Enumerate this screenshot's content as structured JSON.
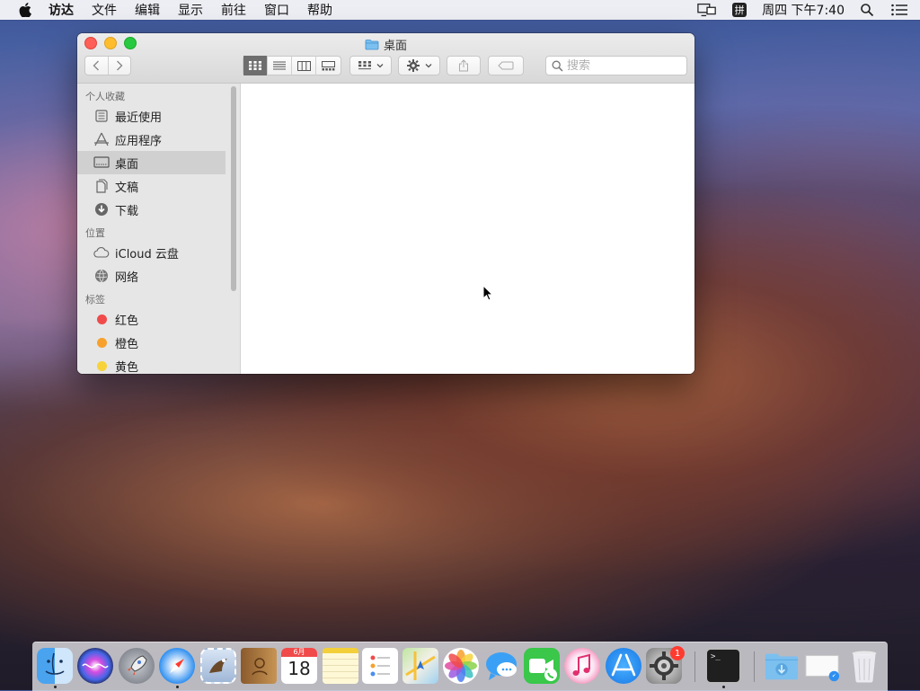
{
  "menubar": {
    "items": [
      "访达",
      "文件",
      "编辑",
      "显示",
      "前往",
      "窗口",
      "帮助"
    ],
    "input_method": "拼",
    "clock": "周四 下午7:40"
  },
  "window": {
    "title": "桌面",
    "search_placeholder": "搜索",
    "sidebar": {
      "favorites_header": "个人收藏",
      "favorites": [
        {
          "label": "最近使用",
          "icon": "recents-icon"
        },
        {
          "label": "应用程序",
          "icon": "applications-icon"
        },
        {
          "label": "桌面",
          "icon": "desktop-icon",
          "selected": true
        },
        {
          "label": "文稿",
          "icon": "documents-icon"
        },
        {
          "label": "下载",
          "icon": "downloads-icon"
        }
      ],
      "locations_header": "位置",
      "locations": [
        {
          "label": "iCloud 云盘",
          "icon": "icloud-icon"
        },
        {
          "label": "网络",
          "icon": "network-icon"
        }
      ],
      "tags_header": "标签",
      "tags": [
        {
          "label": "红色",
          "color": "#f04a4a"
        },
        {
          "label": "橙色",
          "color": "#f7a12c"
        },
        {
          "label": "黄色",
          "color": "#f7d23a"
        }
      ]
    }
  },
  "dock": {
    "apps": [
      {
        "name": "finder-app",
        "running": true
      },
      {
        "name": "siri-app"
      },
      {
        "name": "launchpad-app"
      },
      {
        "name": "safari-app",
        "running": true
      },
      {
        "name": "mail-app"
      },
      {
        "name": "contacts-app"
      },
      {
        "name": "calendar-app",
        "month": "6月",
        "day": "18"
      },
      {
        "name": "notes-app"
      },
      {
        "name": "reminders-app"
      },
      {
        "name": "maps-app"
      },
      {
        "name": "photos-app"
      },
      {
        "name": "messages-app"
      },
      {
        "name": "facetime-app"
      },
      {
        "name": "itunes-app"
      },
      {
        "name": "app-store-app"
      },
      {
        "name": "system-preferences-app",
        "badge": "1"
      },
      {
        "name": "terminal-app",
        "running": true
      },
      {
        "name": "downloads-folder"
      },
      {
        "name": "desktop-document"
      },
      {
        "name": "trash"
      }
    ],
    "terminal_prompt": ">_"
  }
}
